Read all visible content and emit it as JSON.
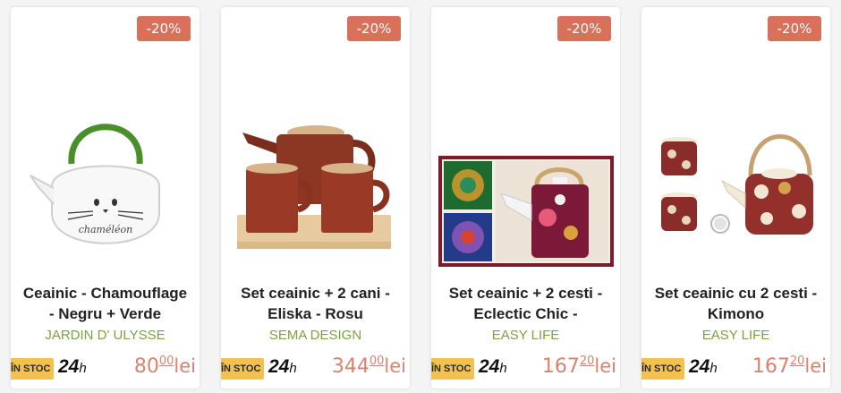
{
  "products": [
    {
      "discount": "-20%",
      "title_line1": "Ceainic - Chamouflage",
      "title_line2": "- Negru + Verde",
      "brand": "JARDIN D' ULYSSE",
      "stock_label": "ÎN STOC",
      "delivery_hours": "24",
      "delivery_unit": "h",
      "price_int": "80",
      "price_dec": "00",
      "currency": "lei",
      "kettle_text": "chaméléon",
      "icon": "glass-kettle-image"
    },
    {
      "discount": "-20%",
      "title_line1": "Set ceainic + 2 cani -",
      "title_line2": "Eliska - Rosu",
      "brand": "SEMA DESIGN",
      "stock_label": "ÎN STOC",
      "delivery_hours": "24",
      "delivery_unit": "h",
      "price_int": "344",
      "price_dec": "00",
      "currency": "lei",
      "icon": "red-teapot-set-image"
    },
    {
      "discount": "-20%",
      "title_line1": "Set ceainic + 2 cesti -",
      "title_line2": "Eclectic Chic -",
      "brand": "EASY LIFE",
      "stock_label": "ÎN STOC",
      "delivery_hours": "24",
      "delivery_unit": "h",
      "price_int": "167",
      "price_dec": "20",
      "currency": "lei",
      "icon": "boxed-teapot-set-image"
    },
    {
      "discount": "-20%",
      "title_line1": "Set ceainic cu 2 cesti -",
      "title_line2": "Kimono",
      "brand": "EASY LIFE",
      "stock_label": "ÎN STOC",
      "delivery_hours": "24",
      "delivery_unit": "h",
      "price_int": "167",
      "price_dec": "20",
      "currency": "lei",
      "icon": "kimono-teapot-set-image"
    }
  ],
  "colors": {
    "badge": "#d9705a",
    "brand": "#7da13d",
    "price": "#d9826f",
    "stock": "#f2c14e"
  }
}
